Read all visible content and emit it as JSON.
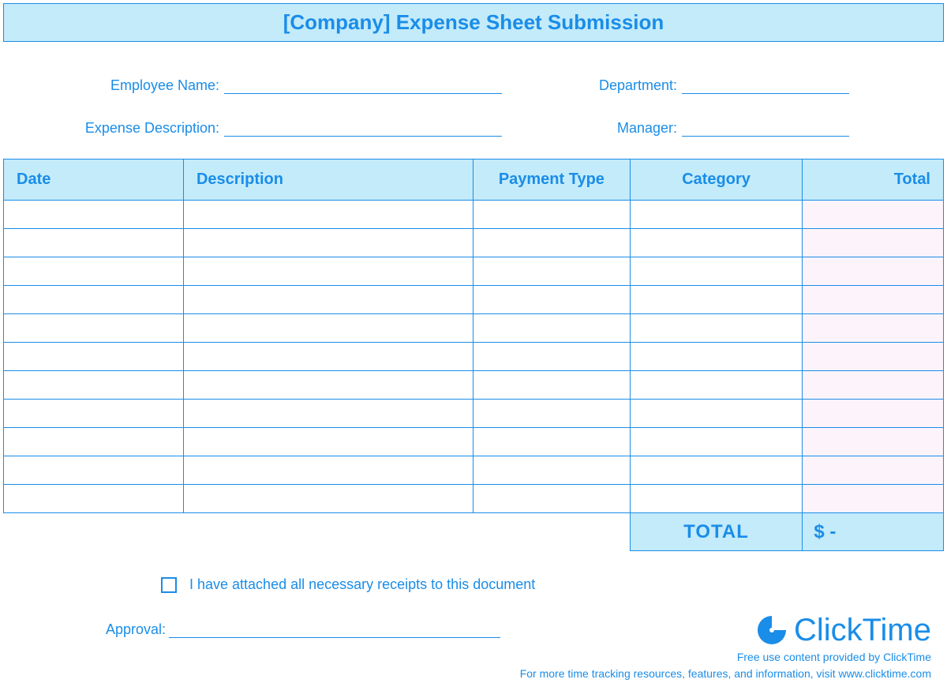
{
  "header": {
    "title": "[Company] Expense Sheet Submission"
  },
  "info": {
    "employee_name_label": "Employee Name:",
    "department_label": "Department:",
    "expense_description_label": "Expense Description:",
    "manager_label": "Manager:"
  },
  "table": {
    "headers": {
      "date": "Date",
      "description": "Description",
      "payment_type": "Payment Type",
      "category": "Category",
      "total": "Total"
    },
    "rows": [
      {
        "date": "",
        "description": "",
        "payment_type": "",
        "category": "",
        "total": ""
      },
      {
        "date": "",
        "description": "",
        "payment_type": "",
        "category": "",
        "total": ""
      },
      {
        "date": "",
        "description": "",
        "payment_type": "",
        "category": "",
        "total": ""
      },
      {
        "date": "",
        "description": "",
        "payment_type": "",
        "category": "",
        "total": ""
      },
      {
        "date": "",
        "description": "",
        "payment_type": "",
        "category": "",
        "total": ""
      },
      {
        "date": "",
        "description": "",
        "payment_type": "",
        "category": "",
        "total": ""
      },
      {
        "date": "",
        "description": "",
        "payment_type": "",
        "category": "",
        "total": ""
      },
      {
        "date": "",
        "description": "",
        "payment_type": "",
        "category": "",
        "total": ""
      },
      {
        "date": "",
        "description": "",
        "payment_type": "",
        "category": "",
        "total": ""
      },
      {
        "date": "",
        "description": "",
        "payment_type": "",
        "category": "",
        "total": ""
      },
      {
        "date": "",
        "description": "",
        "payment_type": "",
        "category": "",
        "total": ""
      }
    ],
    "total_label": "TOTAL",
    "total_value": "$        -"
  },
  "receipts": {
    "text": "I have attached all necessary receipts to this document"
  },
  "approval": {
    "label": "Approval:"
  },
  "footer": {
    "brand": "ClickTime",
    "line1": "Free use content provided by ClickTime",
    "line2": "For more time tracking resources, features, and information, visit www.clicktime.com"
  }
}
